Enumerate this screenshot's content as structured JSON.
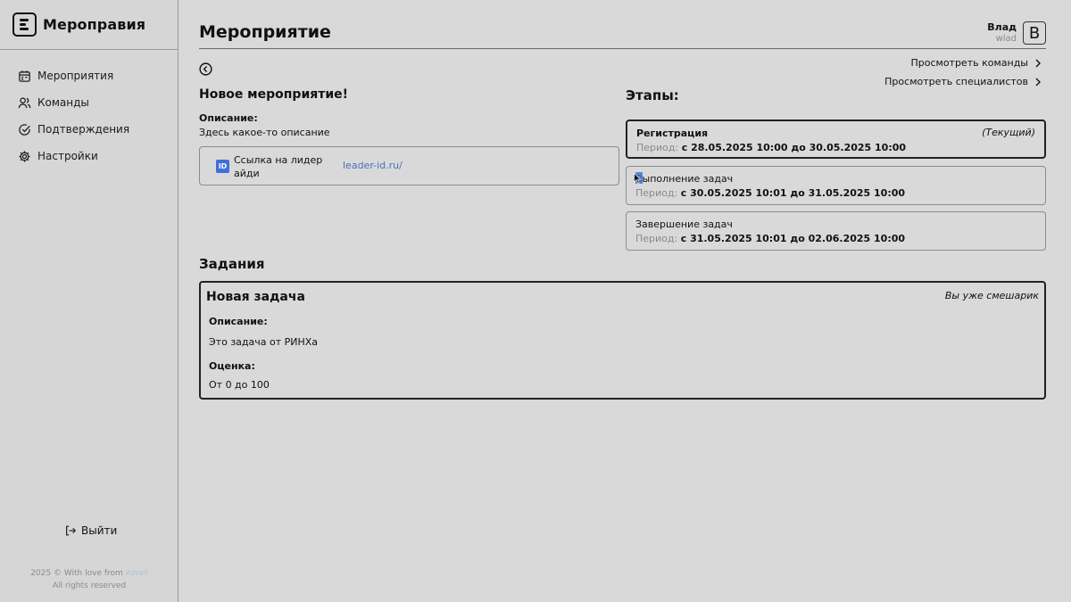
{
  "sidebar": {
    "brand": "Мероправия",
    "items": [
      {
        "label": "Мероприятия",
        "icon": "calendar-icon"
      },
      {
        "label": "Команды",
        "icon": "users-icon"
      },
      {
        "label": "Подтверждения",
        "icon": "check-circle-icon"
      },
      {
        "label": "Настройки",
        "icon": "gear-icon"
      }
    ],
    "logout": "Выйти",
    "footer": {
      "line1_prefix": "2025 © With love from",
      "author": "Azrail",
      "line2": "All rights reserved"
    }
  },
  "header": {
    "title": "Мероприятие",
    "user_name": "Влад",
    "user_login": "wlad",
    "avatar_letter": "B"
  },
  "links": {
    "teams": "Просмотреть команды",
    "specialists": "Просмотреть специалистов"
  },
  "event": {
    "title": "Новое мероприятие!",
    "desc_label": "Описание:",
    "desc": "Здесь какое-то описание",
    "leader_label": "Ссылка на лидер айди",
    "leader_url": "leader-id.ru/",
    "leader_icon": "ID"
  },
  "stages": {
    "title": "Этапы:",
    "period_label": "Период:",
    "items": [
      {
        "name": "Регистрация",
        "status": "(Текущий)",
        "period": "с 28.05.2025 10:00 до 30.05.2025 10:00"
      },
      {
        "name": "Выполнение задач",
        "status": "",
        "period": "с 30.05.2025 10:01 до 31.05.2025 10:00"
      },
      {
        "name": "Завершение задач",
        "status": "",
        "period": "с 31.05.2025 10:01 до 02.06.2025 10:00"
      }
    ]
  },
  "tasks": {
    "title": "Задания",
    "items": [
      {
        "name": "Новая задача",
        "badge": "Вы уже смешарик",
        "desc_label": "Описание:",
        "desc": "Это задача от РИНХа",
        "score_label": "Оценка:",
        "score": "От 0 до 100"
      }
    ]
  },
  "colors": {
    "background": "#d9d9d9",
    "link": "#4a6fb8",
    "leader_icon": "#3f6fd8"
  }
}
